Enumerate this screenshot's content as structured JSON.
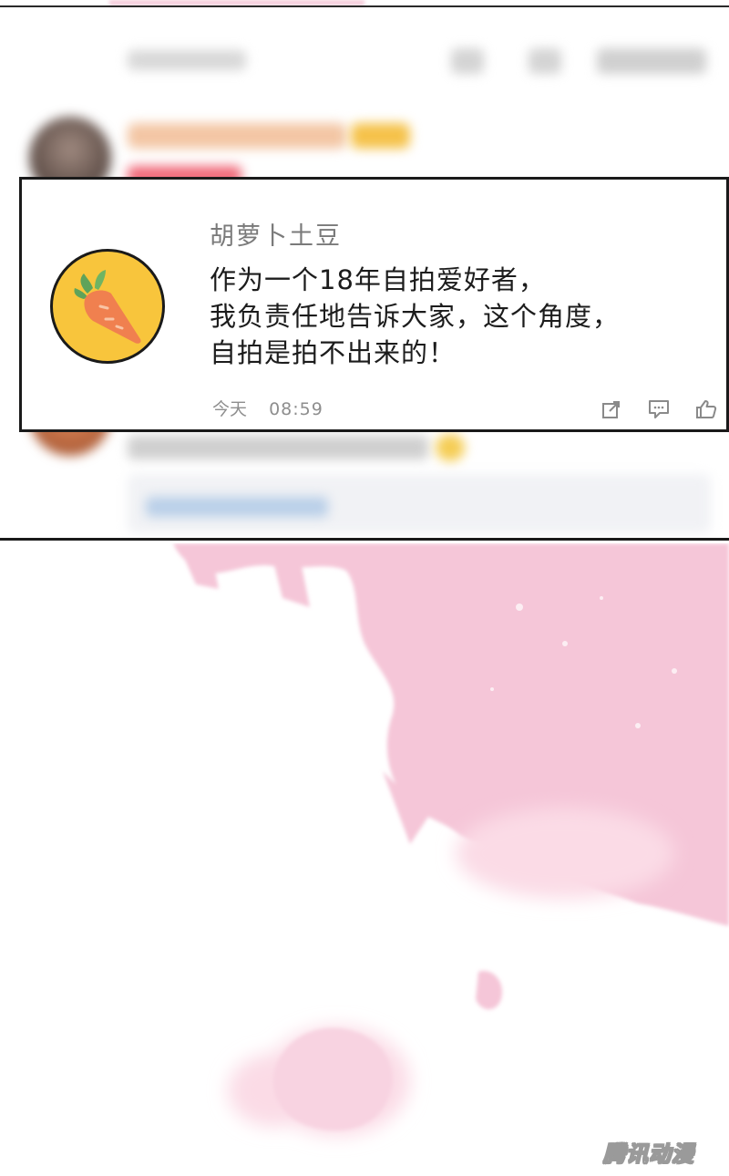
{
  "comment": {
    "username": "胡萝卜土豆",
    "avatar_icon": "carrot-icon",
    "avatar_color": "#f8c53c",
    "lines": [
      "作为一个18年自拍爱好者，",
      "我负责任地告诉大家，这个角度，",
      "自拍是拍不出来的！"
    ],
    "date": "今天",
    "time": "08:59",
    "actions": [
      "share-icon",
      "reply-icon",
      "like-icon"
    ]
  },
  "splash_color": "#f5c6d8",
  "watermark": "腾讯动漫"
}
